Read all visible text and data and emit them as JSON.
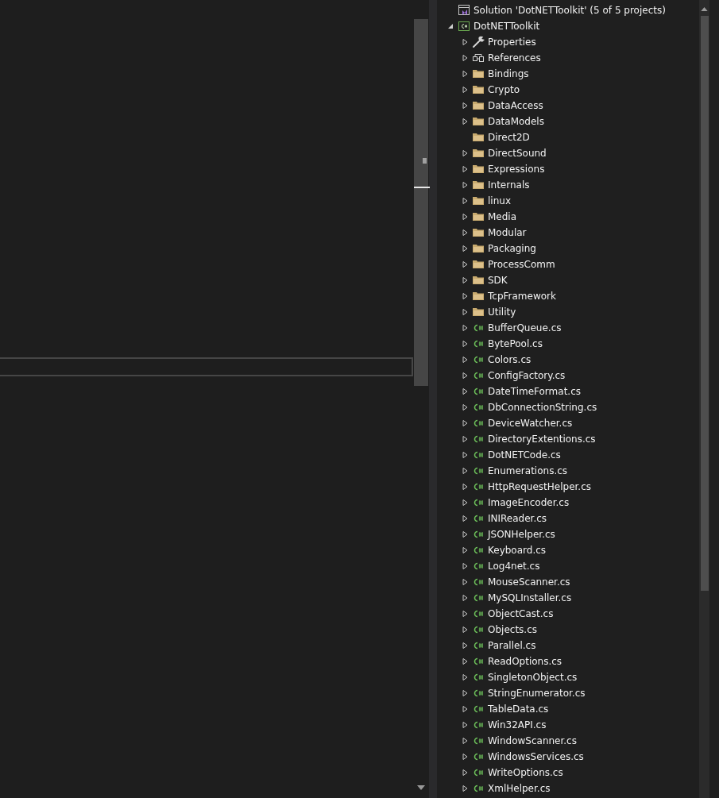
{
  "solution_explorer": {
    "solution": {
      "label": "Solution 'DotNETToolkit' (5 of 5 projects)",
      "children": [
        {
          "label": "DotNETToolkit",
          "kind": "project",
          "expandable": true,
          "expanded": true,
          "children": [
            {
              "label": "Properties",
              "kind": "properties",
              "expandable": true
            },
            {
              "label": "References",
              "kind": "references",
              "expandable": true
            },
            {
              "label": "Bindings",
              "kind": "folder",
              "expandable": true
            },
            {
              "label": "Crypto",
              "kind": "folder",
              "expandable": true
            },
            {
              "label": "DataAccess",
              "kind": "folder",
              "expandable": true
            },
            {
              "label": "DataModels",
              "kind": "folder",
              "expandable": true
            },
            {
              "label": "Direct2D",
              "kind": "folder",
              "expandable": false
            },
            {
              "label": "DirectSound",
              "kind": "folder",
              "expandable": true
            },
            {
              "label": "Expressions",
              "kind": "folder",
              "expandable": true
            },
            {
              "label": "Internals",
              "kind": "folder",
              "expandable": true
            },
            {
              "label": "linux",
              "kind": "folder",
              "expandable": true
            },
            {
              "label": "Media",
              "kind": "folder",
              "expandable": true
            },
            {
              "label": "Modular",
              "kind": "folder",
              "expandable": true
            },
            {
              "label": "Packaging",
              "kind": "folder",
              "expandable": true
            },
            {
              "label": "ProcessComm",
              "kind": "folder",
              "expandable": true
            },
            {
              "label": "SDK",
              "kind": "folder",
              "expandable": true
            },
            {
              "label": "TcpFramework",
              "kind": "folder",
              "expandable": true
            },
            {
              "label": "Utility",
              "kind": "folder",
              "expandable": true
            },
            {
              "label": "BufferQueue.cs",
              "kind": "csfile",
              "expandable": true
            },
            {
              "label": "BytePool.cs",
              "kind": "csfile",
              "expandable": true
            },
            {
              "label": "Colors.cs",
              "kind": "csfile",
              "expandable": true
            },
            {
              "label": "ConfigFactory.cs",
              "kind": "csfile",
              "expandable": true
            },
            {
              "label": "DateTimeFormat.cs",
              "kind": "csfile",
              "expandable": true
            },
            {
              "label": "DbConnectionString.cs",
              "kind": "csfile",
              "expandable": true
            },
            {
              "label": "DeviceWatcher.cs",
              "kind": "csfile",
              "expandable": true
            },
            {
              "label": "DirectoryExtentions.cs",
              "kind": "csfile",
              "expandable": true
            },
            {
              "label": "DotNETCode.cs",
              "kind": "csfile",
              "expandable": true
            },
            {
              "label": "Enumerations.cs",
              "kind": "csfile",
              "expandable": true
            },
            {
              "label": "HttpRequestHelper.cs",
              "kind": "csfile",
              "expandable": true
            },
            {
              "label": "ImageEncoder.cs",
              "kind": "csfile",
              "expandable": true
            },
            {
              "label": "INIReader.cs",
              "kind": "csfile",
              "expandable": true
            },
            {
              "label": "JSONHelper.cs",
              "kind": "csfile",
              "expandable": true
            },
            {
              "label": "Keyboard.cs",
              "kind": "csfile",
              "expandable": true
            },
            {
              "label": "Log4net.cs",
              "kind": "csfile",
              "expandable": true
            },
            {
              "label": "MouseScanner.cs",
              "kind": "csfile",
              "expandable": true
            },
            {
              "label": "MySQLInstaller.cs",
              "kind": "csfile",
              "expandable": true
            },
            {
              "label": "ObjectCast.cs",
              "kind": "csfile",
              "expandable": true
            },
            {
              "label": "Objects.cs",
              "kind": "csfile",
              "expandable": true
            },
            {
              "label": "Parallel.cs",
              "kind": "csfile",
              "expandable": true
            },
            {
              "label": "ReadOptions.cs",
              "kind": "csfile",
              "expandable": true
            },
            {
              "label": "SingletonObject.cs",
              "kind": "csfile",
              "expandable": true
            },
            {
              "label": "StringEnumerator.cs",
              "kind": "csfile",
              "expandable": true
            },
            {
              "label": "TableData.cs",
              "kind": "csfile",
              "expandable": true
            },
            {
              "label": "Win32API.cs",
              "kind": "csfile",
              "expandable": true
            },
            {
              "label": "WindowScanner.cs",
              "kind": "csfile",
              "expandable": true
            },
            {
              "label": "WindowsServices.cs",
              "kind": "csfile",
              "expandable": true
            },
            {
              "label": "WriteOptions.cs",
              "kind": "csfile",
              "expandable": true
            },
            {
              "label": "XmlHelper.cs",
              "kind": "csfile",
              "expandable": true
            }
          ]
        }
      ]
    }
  }
}
